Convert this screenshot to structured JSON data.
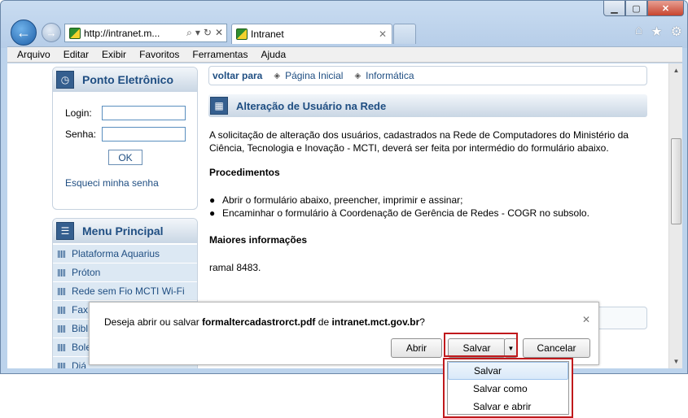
{
  "browser": {
    "address": "http://intranet.m...",
    "tab_title": "Intranet",
    "menu": [
      "Arquivo",
      "Editar",
      "Exibir",
      "Favoritos",
      "Ferramentas",
      "Ajuda"
    ]
  },
  "sidebar": {
    "ponto": {
      "title": "Ponto Eletrônico",
      "login_label": "Login:",
      "senha_label": "Senha:",
      "ok_label": "OK",
      "forgot_label": "Esqueci minha senha"
    },
    "menu_principal": {
      "title": "Menu Principal",
      "items": [
        "Plataforma Aquarius",
        "Próton",
        "Rede sem Fio MCTI Wi-Fi",
        "Fax",
        "Bibl",
        "Bole",
        "Diá"
      ]
    }
  },
  "breadcrumb": {
    "back": "voltar para",
    "links": [
      "Página Inicial",
      "Informática"
    ]
  },
  "article": {
    "title": "Alteração de Usuário na Rede",
    "intro": "A solicitação de alteração dos usuários, cadastrados na Rede de Computadores do Ministério da Ciência, Tecnologia e Inovação - MCTI, deverá ser feita por intermédio do formulário abaixo.",
    "procedimentos_head": "Procedimentos",
    "steps": [
      "Abrir o formulário abaixo, preencher, imprimir e assinar;",
      "Encaminhar o formulário à Coordenação de Gerência de Redes - COGR no subsolo."
    ],
    "mais_info_head": "Maiores informações",
    "ramal": "ramal 8483."
  },
  "download_bar": {
    "prefix": "Deseja abrir ou salvar ",
    "filename": "formaltercadastrorct.pdf",
    "middle": " de ",
    "host": "intranet.mct.gov.br",
    "suffix": "?",
    "abrir": "Abrir",
    "salvar": "Salvar",
    "cancelar": "Cancelar"
  },
  "save_menu": {
    "items": [
      "Salvar",
      "Salvar como",
      "Salvar e abrir"
    ],
    "selected": "Salvar"
  },
  "colors": {
    "link_blue": "#1f4e82",
    "highlight_red": "#c0191c"
  }
}
